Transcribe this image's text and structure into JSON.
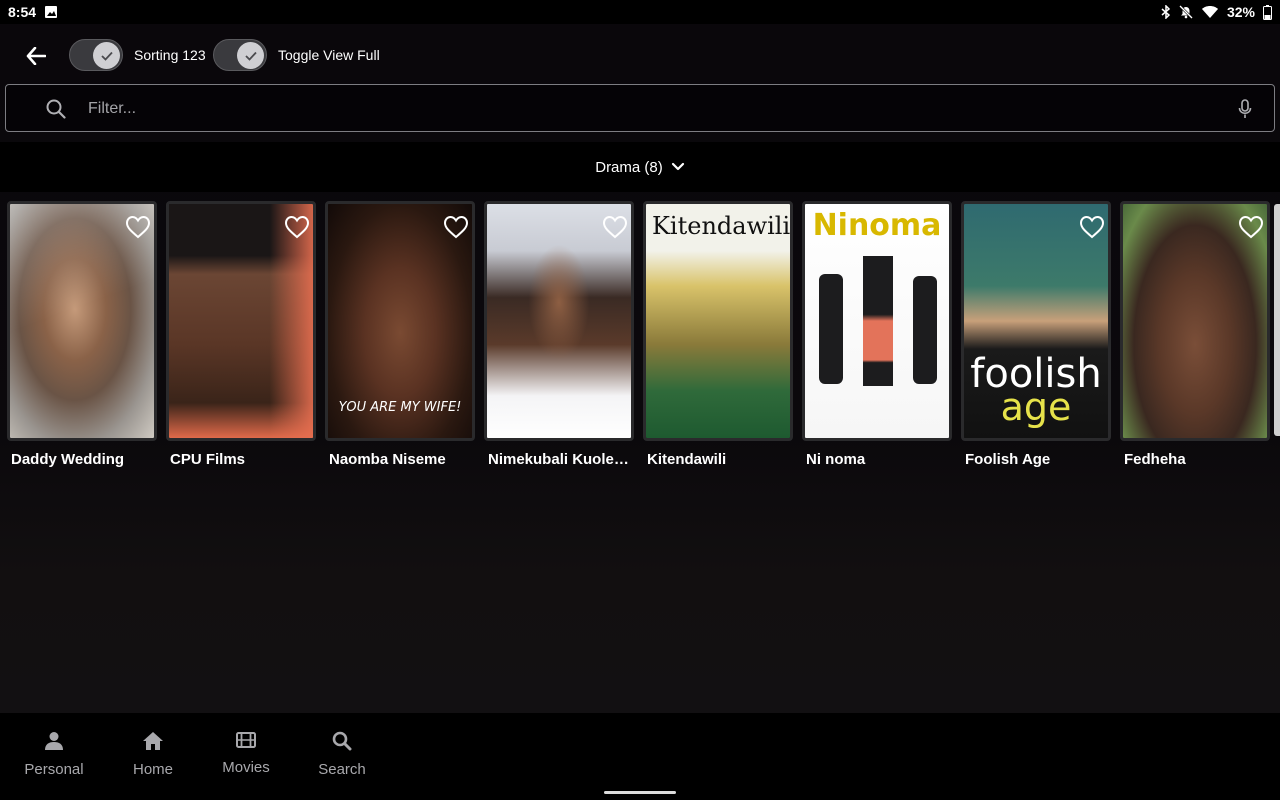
{
  "status_bar": {
    "time": "8:54",
    "battery": "32%"
  },
  "toolbar": {
    "toggle1_label": "Sorting 123",
    "toggle2_label": "Toggle View Full"
  },
  "search": {
    "placeholder": "Filter..."
  },
  "category": {
    "label": "Drama (8)"
  },
  "movies": [
    {
      "title": "Daddy Wedding"
    },
    {
      "title": "CPU Films"
    },
    {
      "title": "Naomba Niseme",
      "poster_text": "YOU ARE MY WIFE!"
    },
    {
      "title": "Nimekubali Kuolewa"
    },
    {
      "title": "Kitendawili",
      "poster_text": "Kitendawili"
    },
    {
      "title": "Ni noma",
      "poster_text": "Ninoma"
    },
    {
      "title": "Foolish Age",
      "poster_text_1": "foolish",
      "poster_text_2": "age"
    },
    {
      "title": "Fedheha"
    }
  ],
  "bottom_nav": [
    {
      "label": "Personal",
      "icon": "person-icon"
    },
    {
      "label": "Home",
      "icon": "home-icon"
    },
    {
      "label": "Movies",
      "icon": "film-icon"
    },
    {
      "label": "Search",
      "icon": "search-icon"
    }
  ],
  "colors": {
    "background": "#0b090c",
    "accent": "#ffffff",
    "nav_inactive": "#a8a8ac"
  }
}
